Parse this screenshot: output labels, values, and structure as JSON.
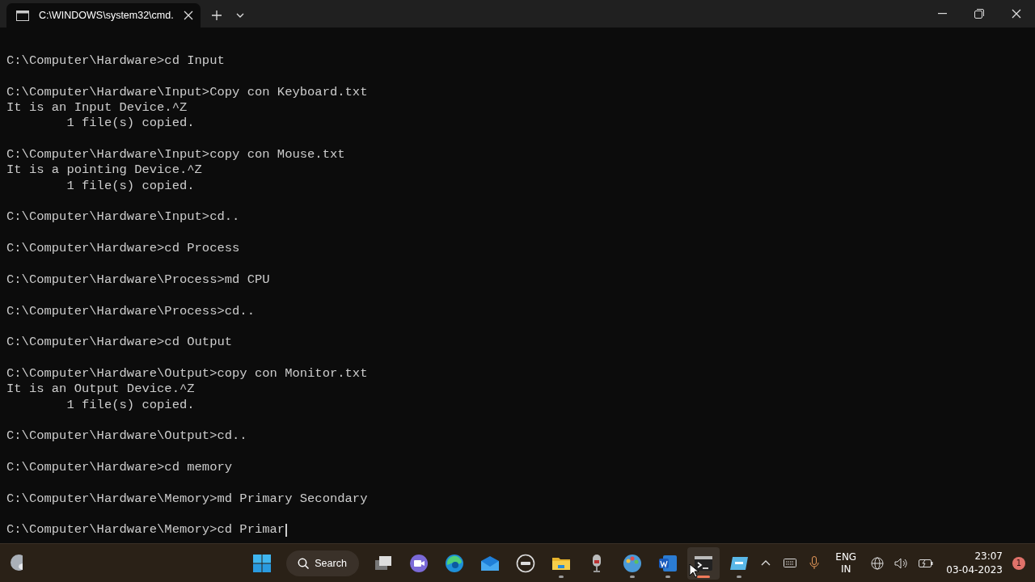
{
  "window": {
    "tab_title": "C:\\WINDOWS\\system32\\cmd.",
    "tab_selected": true
  },
  "terminal": {
    "cursor_visible": true,
    "entries": [
      {
        "lines": [
          "C:\\Computer\\Hardware>cd Input"
        ]
      },
      {
        "lines": [
          "C:\\Computer\\Hardware\\Input>Copy con Keyboard.txt",
          "It is an Input Device.^Z",
          "        1 file(s) copied."
        ]
      },
      {
        "lines": [
          "C:\\Computer\\Hardware\\Input>copy con Mouse.txt",
          "It is a pointing Device.^Z",
          "        1 file(s) copied."
        ]
      },
      {
        "lines": [
          "C:\\Computer\\Hardware\\Input>cd.."
        ]
      },
      {
        "lines": [
          "C:\\Computer\\Hardware>cd Process"
        ]
      },
      {
        "lines": [
          "C:\\Computer\\Hardware\\Process>md CPU"
        ]
      },
      {
        "lines": [
          "C:\\Computer\\Hardware\\Process>cd.."
        ]
      },
      {
        "lines": [
          "C:\\Computer\\Hardware>cd Output"
        ]
      },
      {
        "lines": [
          "C:\\Computer\\Hardware\\Output>copy con Monitor.txt",
          "It is an Output Device.^Z",
          "        1 file(s) copied."
        ]
      },
      {
        "lines": [
          "C:\\Computer\\Hardware\\Output>cd.."
        ]
      },
      {
        "lines": [
          "C:\\Computer\\Hardware>cd memory"
        ]
      },
      {
        "lines": [
          "C:\\Computer\\Hardware\\Memory>md Primary Secondary"
        ]
      },
      {
        "lines": [
          "C:\\Computer\\Hardware\\Memory>cd Primar"
        ]
      }
    ]
  },
  "taskbar": {
    "search_label": "Search",
    "apps": [
      {
        "kind": "taskview",
        "running": false,
        "active": false
      },
      {
        "kind": "chat",
        "running": false,
        "active": false
      },
      {
        "kind": "browser",
        "running": false,
        "active": false
      },
      {
        "kind": "mail",
        "running": false,
        "active": false
      },
      {
        "kind": "dell",
        "running": false,
        "active": false
      },
      {
        "kind": "folder",
        "running": true,
        "active": false
      },
      {
        "kind": "microphone",
        "running": false,
        "active": false
      },
      {
        "kind": "paint",
        "running": true,
        "active": false
      },
      {
        "kind": "word",
        "running": true,
        "active": false
      },
      {
        "kind": "terminal",
        "running": true,
        "active": true
      },
      {
        "kind": "screen",
        "running": true,
        "active": false
      }
    ],
    "language": [
      "ENG",
      "IN"
    ],
    "time": "23:07",
    "date": "03-04-2023",
    "notification_count": "1"
  }
}
